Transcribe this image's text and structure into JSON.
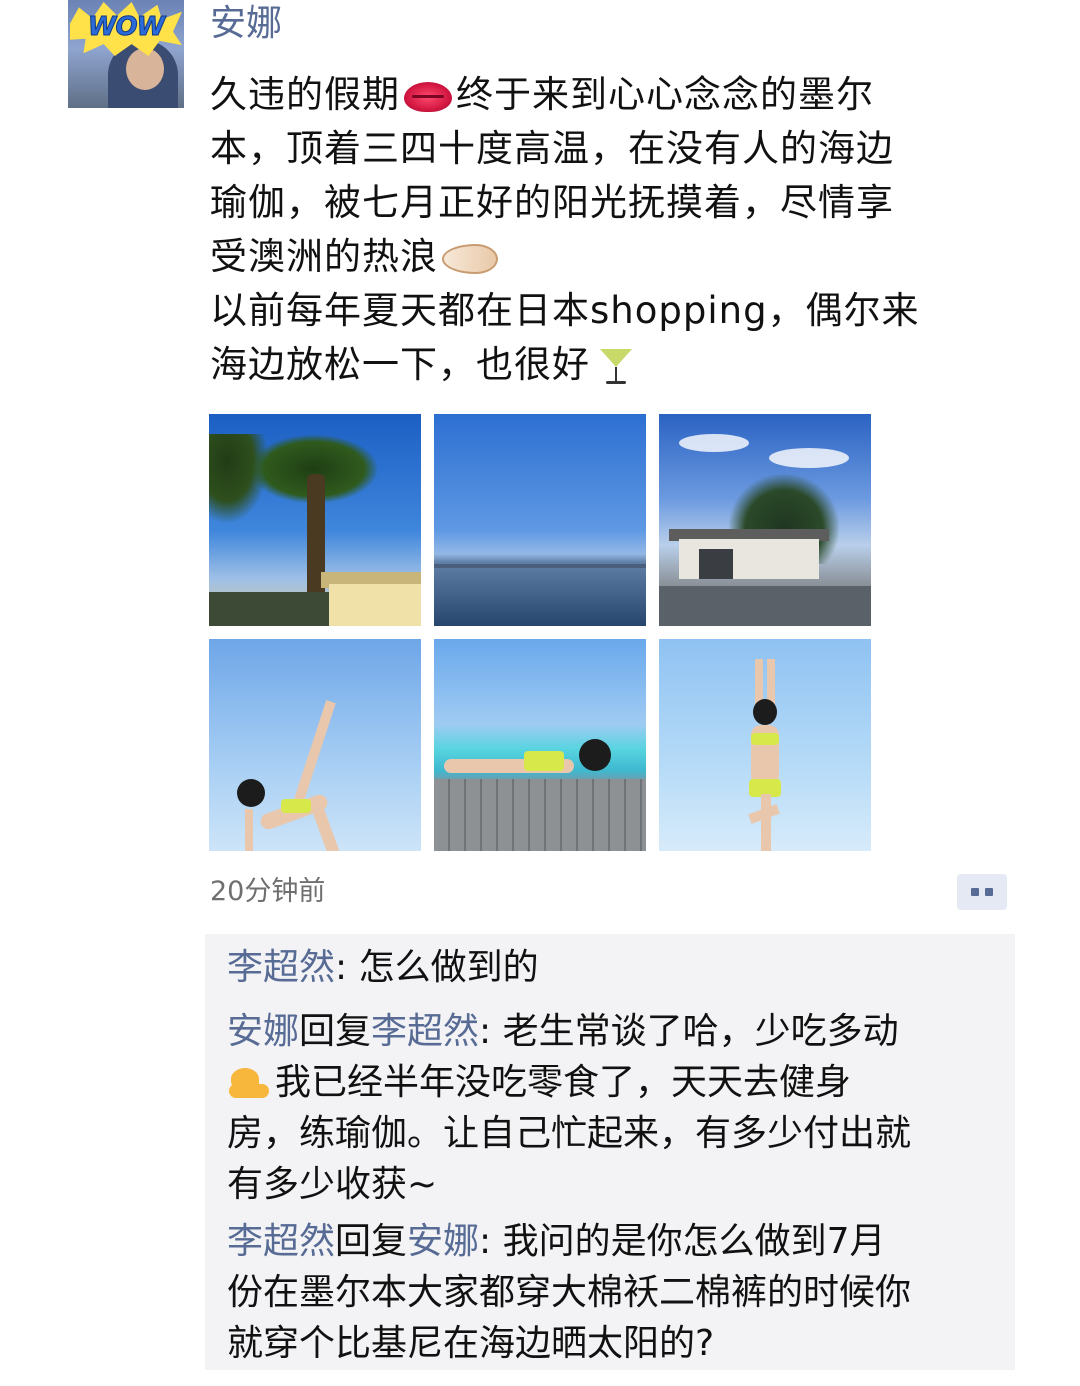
{
  "post": {
    "nickname": "安娜",
    "avatar_badge": "WOW",
    "text_lines": [
      "久违的假期",
      "终于来到心心念念的墨尔",
      "本，顶着三四十度高温，在没有人的海边",
      "瑜伽，被七月正好的阳光抚摸着，尽情享",
      "受澳洲的热浪",
      "以前每年夏天都在日本shopping，偶尔来",
      "海边放松一下，也很好"
    ],
    "icons": [
      "lips-emoji",
      "sandal-emoji",
      "cocktail-emoji"
    ],
    "photos": [
      "palm-trees",
      "sea-horizon",
      "house-trees",
      "yoga-pose-1",
      "yoga-pose-2",
      "yoga-pose-3"
    ],
    "timestamp": "20分钟前"
  },
  "comments": [
    {
      "author": "李超然",
      "reply_word": "",
      "reply_to": "",
      "separator": ": ",
      "lines": [
        "怎么做到的"
      ]
    },
    {
      "author": "安娜",
      "reply_word": "回复",
      "reply_to": "李超然",
      "separator": ": ",
      "lines": [
        "老生常谈了哈，少吃多动",
        "我已经半年没吃零食了，天天去健身",
        "房，练瑜伽。让自己忙起来，有多少付出就",
        "有多少收获~"
      ]
    },
    {
      "author": "李超然",
      "reply_word": "回复",
      "reply_to": "安娜",
      "separator": ": ",
      "lines": [
        "我问的是你怎么做到7月",
        "份在墨尔本大家都穿大棉袄二棉裤的时候你",
        "就穿个比基尼在海边晒太阳的?"
      ]
    }
  ],
  "colors": {
    "link_name": "#576b95",
    "comment_bg": "#f3f3f5",
    "timestamp": "#6f6f6f"
  }
}
